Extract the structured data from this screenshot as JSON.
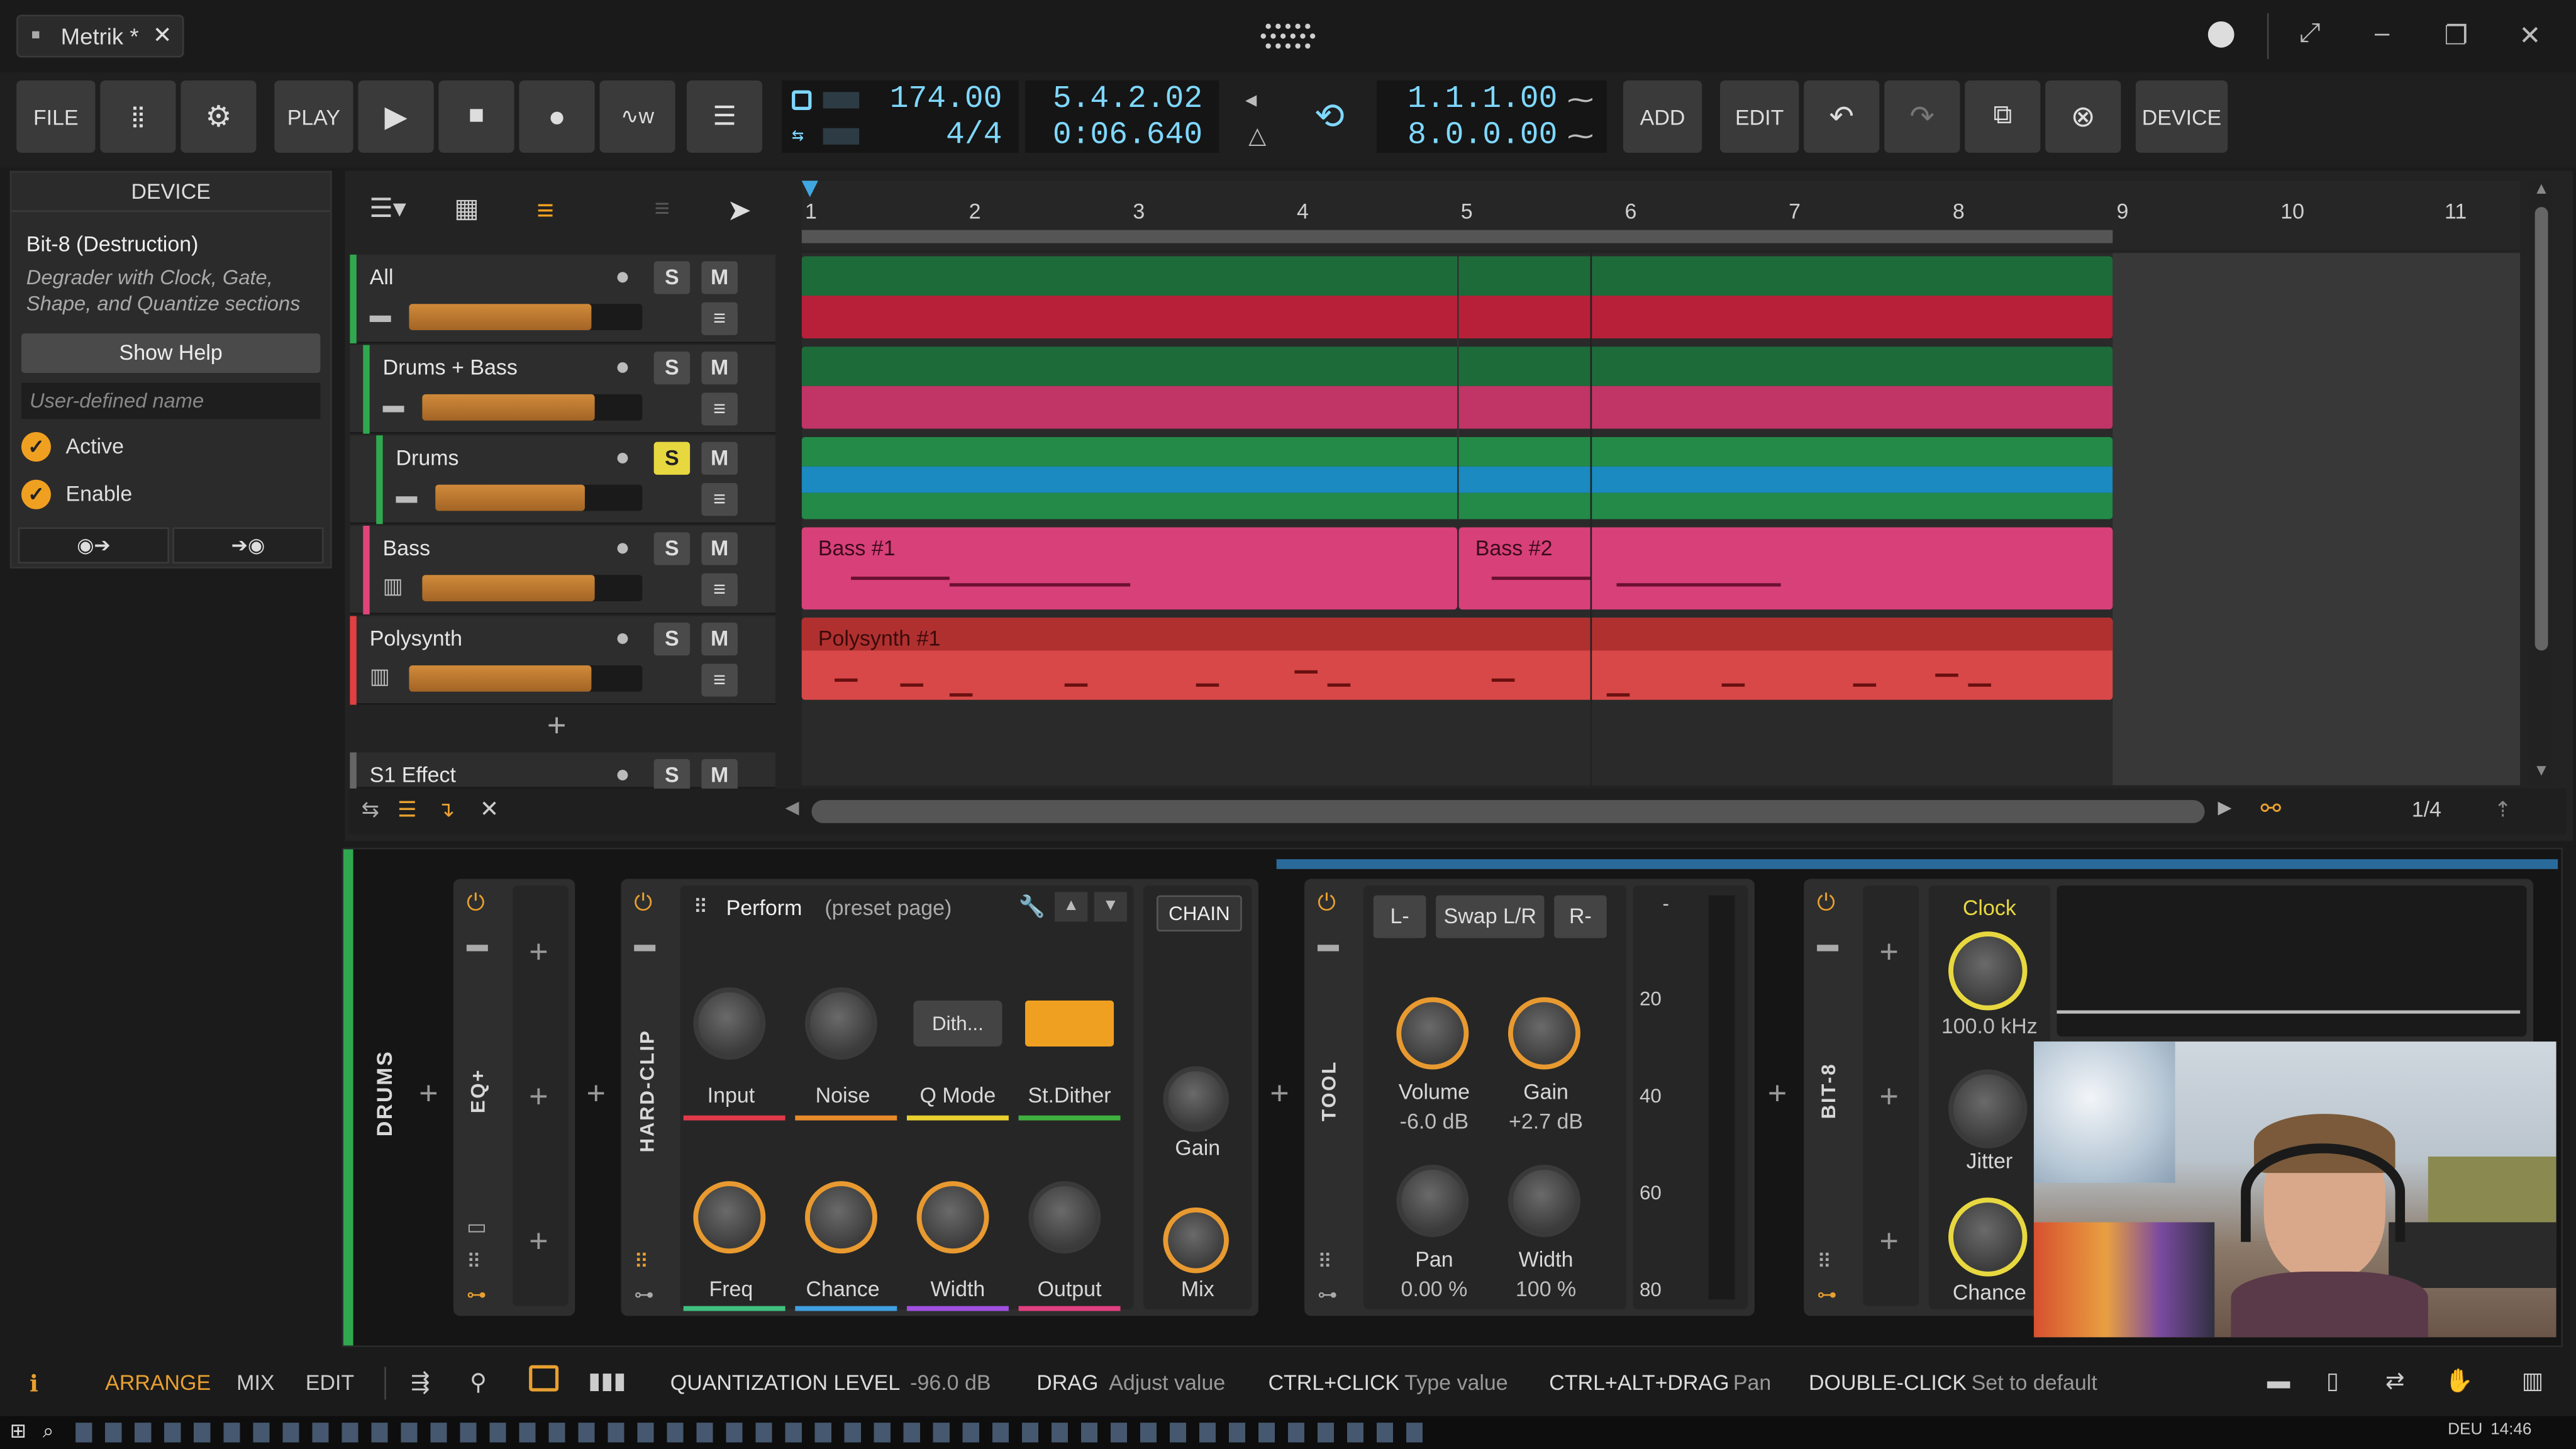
{
  "window": {
    "tab_title": "Metrik *"
  },
  "transport": {
    "file": "FILE",
    "play": "PLAY",
    "tempo": "174.00",
    "signature": "4/4",
    "position": "5.4.2.02",
    "time": "0:06.640",
    "loop_start": "1.1.1.00",
    "loop_length": "8.0.0.00",
    "add": "ADD",
    "edit": "EDIT",
    "device": "DEVICE"
  },
  "inspector": {
    "header": "DEVICE",
    "device_name": "Bit-8 (Destruction)",
    "description": "Degrader with Clock, Gate, Shape, and Quantize sections",
    "show_help": "Show Help",
    "name_placeholder": "User-defined name",
    "active": "Active",
    "enable": "Enable"
  },
  "ruler": [
    "1",
    "2",
    "3",
    "4",
    "5",
    "6",
    "7",
    "8",
    "9",
    "10",
    "11"
  ],
  "tracks": [
    {
      "name": "All",
      "color": "#2fa84f",
      "level": 0.78
    },
    {
      "name": "Drums + Bass",
      "color": "#2fa84f",
      "level": 0.78
    },
    {
      "name": "Drums",
      "color": "#2fa84f",
      "level": 0.72
    },
    {
      "name": "Bass",
      "color": "#e0447a",
      "level": 0.78
    },
    {
      "name": "Polysynth",
      "color": "#e04040",
      "level": 0.78
    },
    {
      "name": "S1 Effect",
      "color": "#666666",
      "level": 0.0
    }
  ],
  "track_buttons": {
    "solo": "S",
    "mute": "M"
  },
  "clips": {
    "bass1": "Bass #1",
    "bass2": "Bass #2",
    "poly1": "Polysynth #1"
  },
  "arranger_footer": {
    "grid": "1/4"
  },
  "chain": {
    "drums_label": "DRUMS",
    "eq_label": "EQ+",
    "hardclip_label": "HARD-CLIP",
    "perform": "Perform",
    "perform_sub": "(preset page)",
    "dither_select": "Dith...",
    "knobs_row1": [
      "Input",
      "Noise",
      "Q Mode",
      "St.Dither"
    ],
    "knobs_row2": [
      "Freq",
      "Chance",
      "Width",
      "Output"
    ],
    "chain_btn": "CHAIN",
    "chain_gain": "Gain",
    "chain_mix": "Mix",
    "tool_label": "TOOL",
    "l_btn": "L-",
    "swap_btn": "Swap L/R",
    "r_btn": "R-",
    "volume": "Volume",
    "volume_val": "-6.0 dB",
    "gain": "Gain",
    "gain_val": "+2.7 dB",
    "pan": "Pan",
    "pan_val": "0.00 %",
    "width": "Width",
    "width_val": "100 %",
    "meter_scale": [
      "-",
      "20",
      "40",
      "60",
      "80"
    ],
    "bit8_label": "BIT-8",
    "clock": "Clock",
    "clock_val": "100.0 kHz",
    "jitter": "Jitter",
    "chance": "Chance"
  },
  "status": {
    "arrange": "ARRANGE",
    "mix": "MIX",
    "edit": "EDIT",
    "quant_label": "QUANTIZATION LEVEL",
    "quant_val": "-96.0 dB",
    "drag": "DRAG",
    "drag_desc": "Adjust value",
    "ctrl_click": "CTRL+CLICK",
    "ctrl_click_desc": "Type value",
    "ctrl_alt_drag": "CTRL+ALT+DRAG",
    "ctrl_alt_drag_desc": "Pan",
    "dbl_click": "DOUBLE-CLICK",
    "dbl_click_desc": "Set to default"
  },
  "taskbar": {
    "time": "14:46",
    "lang": "DEU"
  }
}
